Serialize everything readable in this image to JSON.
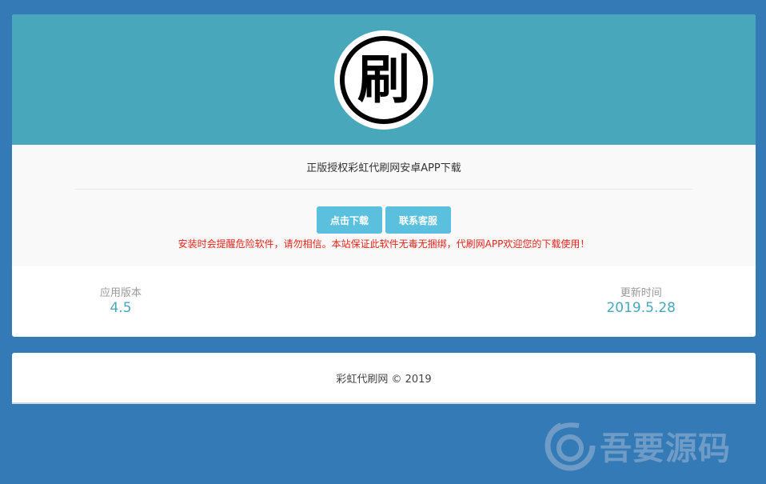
{
  "header": {
    "logo_char": "刷"
  },
  "app": {
    "title": "正版授权彩虹代刷网安卓APP下载"
  },
  "buttons": {
    "download": "点击下载",
    "contact": "联系客服"
  },
  "warning": "安装时会提醒危险软件，请勿相信。本站保证此软件无毒无捆绑，代刷网APP欢迎您的下载使用！",
  "stats": {
    "version_label": "应用版本",
    "version_value": "4.5",
    "update_label": "更新时间",
    "update_value": "2019.5.28"
  },
  "footer": {
    "text": "彩虹代刷网 © 2019"
  },
  "watermark": {
    "text": "吾要源码"
  },
  "colors": {
    "page_bg": "#337ab7",
    "header_bg": "#48a7bb",
    "button_bg": "#5bc0de",
    "warning_text": "#e4231b",
    "stat_value": "#48a7bb"
  }
}
